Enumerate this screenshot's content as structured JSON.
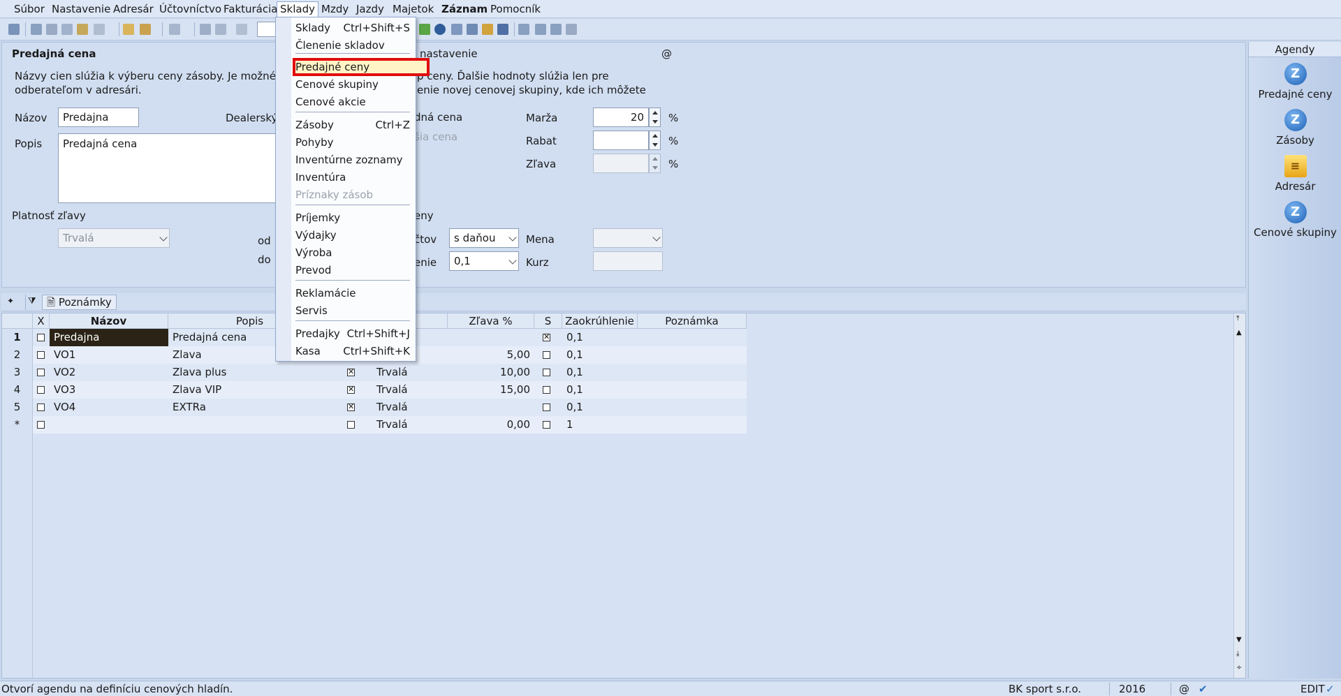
{
  "menubar": {
    "items": [
      "Súbor",
      "Nastavenie",
      "Adresár",
      "Účtovníctvo",
      "Fakturácia",
      "Sklady",
      "Mzdy",
      "Jazdy",
      "Majetok",
      "Záznam",
      "Pomocník"
    ]
  },
  "form": {
    "heading": "Predajná cena",
    "right_heading": "e nastavenie",
    "at_symbol": "@",
    "description_left": "Názvy cien slúžia k výberu ceny zásoby. Je možné ich pri",
    "description_left2": "odberateľom v adresári.",
    "description_right": "p ceny. Ďalšie hodnoty slúžia len pre",
    "description_right2": "enie novej cenovej skupiny, kde ich môžete",
    "nazov_label": "Názov",
    "nazov_value": "Predajna",
    "dealer_label": "Dealerský c",
    "popis_label": "Popis",
    "popis_value": "Predajná cena",
    "cena_label": "dná cena",
    "cena2_label": "šia cena",
    "marza_label": "Marža",
    "marza_value": "20",
    "rabat_label": "Rabat",
    "rabat_value": "",
    "zlava_label": "Zľava",
    "zlava_value": "",
    "pct": "%",
    "platnost_label": "Platnosť zľavy",
    "platnost_value": "Trvalá",
    "od_label": "od",
    "do_label": "do",
    "ceny_label": "eny",
    "uctov_label": "čtov",
    "uctov_value": "s daňou",
    "mena_label": "Mena",
    "mena_value": "",
    "zaokr_label": "enie",
    "zaokr_value": "0,1",
    "kurz_label": "Kurz",
    "kurz_value": ""
  },
  "agendy": {
    "title": "Agendy",
    "items": [
      "Predajné ceny",
      "Zásoby",
      "Adresár",
      "Cenové skupiny"
    ]
  },
  "grid_tabs": {
    "notes_tab": "Poznámky"
  },
  "grid": {
    "headers": [
      "X",
      "Názov",
      "Popis",
      "osť",
      "Zľava %",
      "S",
      "Zaokrúhlenie",
      "Poznámka"
    ],
    "rows": [
      {
        "num": "1",
        "nazov": "Predajna",
        "popis": "Predajná cena",
        "s_flag": "",
        "platnost": "",
        "zlava": "",
        "s": true,
        "zaokr": "0,1",
        "pozn": ""
      },
      {
        "num": "2",
        "nazov": "VO1",
        "popis": "Zlava",
        "s_flag": "",
        "platnost": "",
        "zlava": "5,00",
        "s": false,
        "zaokr": "0,1",
        "pozn": ""
      },
      {
        "num": "3",
        "nazov": "VO2",
        "popis": "Zlava plus",
        "s_flag": "x",
        "platnost": "Trvalá",
        "zlava": "10,00",
        "s": false,
        "zaokr": "0,1",
        "pozn": ""
      },
      {
        "num": "4",
        "nazov": "VO3",
        "popis": "Zlava VIP",
        "s_flag": "x",
        "platnost": "Trvalá",
        "zlava": "15,00",
        "s": false,
        "zaokr": "0,1",
        "pozn": ""
      },
      {
        "num": "5",
        "nazov": "VO4",
        "popis": "EXTRa",
        "s_flag": "x",
        "platnost": "Trvalá",
        "zlava": "",
        "s": false,
        "zaokr": "0,1",
        "pozn": ""
      },
      {
        "num": "*",
        "nazov": "",
        "popis": "",
        "s_flag": "o",
        "platnost": "Trvalá",
        "zlava": "0,00",
        "s": false,
        "zaokr": "1",
        "pozn": ""
      }
    ]
  },
  "menu": {
    "items": [
      {
        "label": "Sklady",
        "shortcut": "Ctrl+Shift+S"
      },
      {
        "label": "Členenie skladov",
        "shortcut": ""
      },
      {
        "label": "Predajné ceny",
        "shortcut": ""
      },
      {
        "label": "Cenové skupiny",
        "shortcut": ""
      },
      {
        "label": "Cenové akcie",
        "shortcut": ""
      },
      {
        "label": "Zásoby",
        "shortcut": "Ctrl+Z"
      },
      {
        "label": "Pohyby",
        "shortcut": ""
      },
      {
        "label": "Inventúrne zoznamy",
        "shortcut": ""
      },
      {
        "label": "Inventúra",
        "shortcut": ""
      },
      {
        "label": "Príznaky zásob",
        "shortcut": ""
      },
      {
        "label": "Príjemky",
        "shortcut": ""
      },
      {
        "label": "Výdajky",
        "shortcut": ""
      },
      {
        "label": "Výroba",
        "shortcut": ""
      },
      {
        "label": "Prevod",
        "shortcut": ""
      },
      {
        "label": "Reklamácie",
        "shortcut": ""
      },
      {
        "label": "Servis",
        "shortcut": ""
      },
      {
        "label": "Predajky",
        "shortcut": "Ctrl+Shift+J"
      },
      {
        "label": "Kasa",
        "shortcut": "Ctrl+Shift+K"
      }
    ]
  },
  "status": {
    "message": "Otvorí agendu na definíciu cenových hladín.",
    "company": "BK sport s.r.o.",
    "year": "2016",
    "at": "@",
    "mode": "EDIT"
  }
}
